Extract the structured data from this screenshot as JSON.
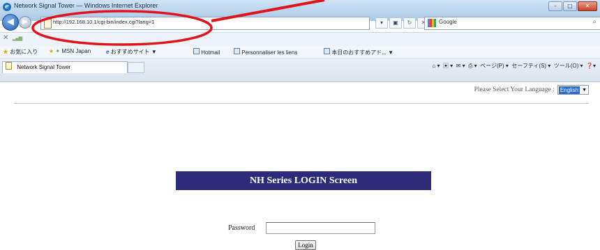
{
  "window": {
    "title": "Network Signal Tower — Windows Internet Explorer",
    "controls": [
      "minimize",
      "maximize",
      "close"
    ]
  },
  "address_bar": {
    "url": "http://192.168.10.1/cgi-bin/index.cgi?lang=1",
    "search_placeholder": "Google"
  },
  "favorites_bar": {
    "favorites_label": "お気に入り",
    "links": [
      "MSN Japan",
      "おすすめサイト ▼",
      "Hotmail",
      "Personnaliser les liens",
      "本日のおすすめアド... ▼"
    ]
  },
  "tab": {
    "label": "Network Signal Tower"
  },
  "command_bar": {
    "items": [
      "ページ(P) ▾",
      "セーフティ(S) ▾",
      "ツール(O) ▾"
    ]
  },
  "page": {
    "language_prompt": "Please Select Your Language :",
    "language_selected": "English",
    "banner_title": "NH Series LOGIN Screen",
    "password_label": "Password",
    "password_value": "",
    "login_label": "Login"
  },
  "annotation": {
    "color": "#e0141b"
  }
}
